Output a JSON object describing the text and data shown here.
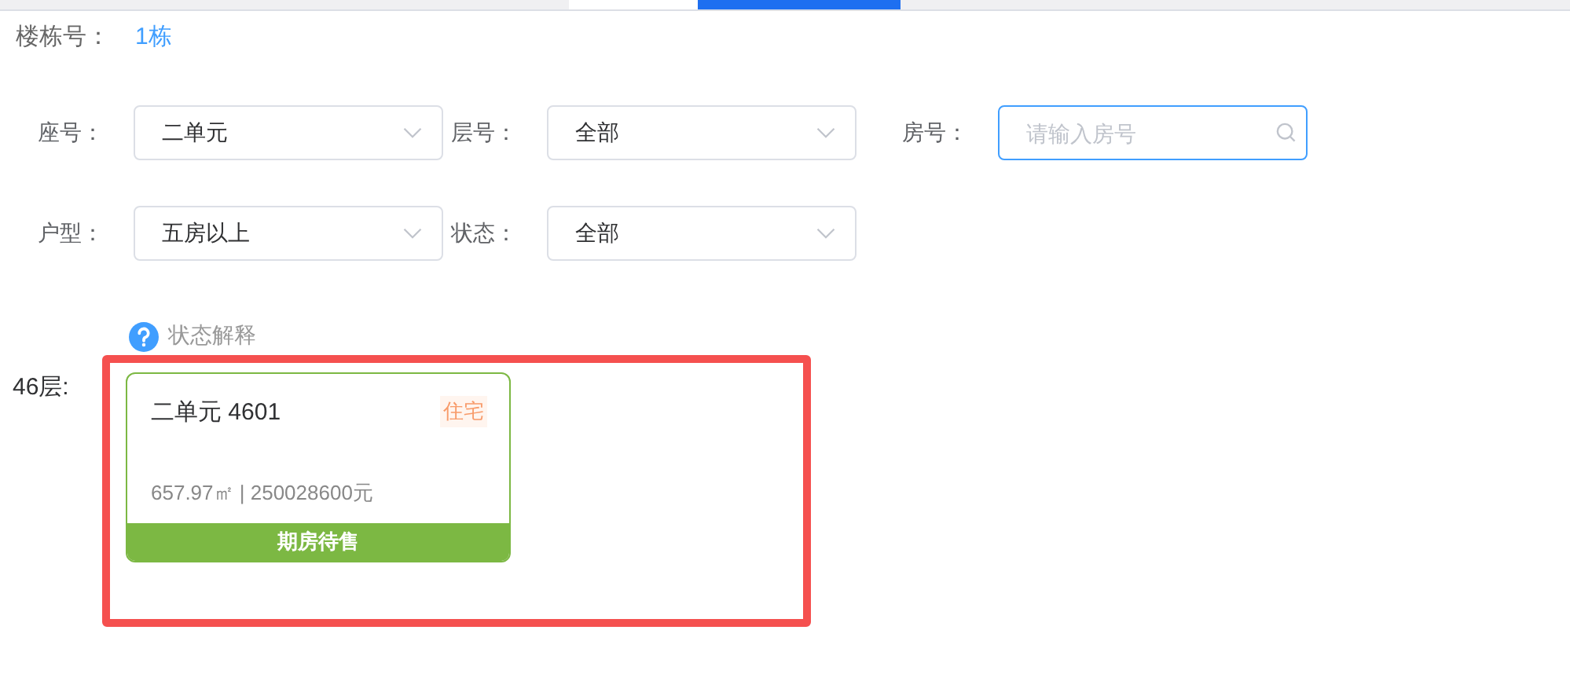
{
  "tabs": [
    {
      "selected": false
    },
    {
      "selected": true
    }
  ],
  "building": {
    "label": "楼栋号：",
    "value": "1栋"
  },
  "filters": [
    {
      "kind": "select",
      "label": "座号：",
      "value": "二单元"
    },
    {
      "kind": "select",
      "label": "层号：",
      "value": "全部"
    },
    {
      "kind": "search",
      "label": "房号：",
      "placeholder": "请输入房号",
      "focused": true
    },
    {
      "kind": "select",
      "label": "户型：",
      "value": "五房以上"
    },
    {
      "kind": "select",
      "label": "状态：",
      "value": "全部"
    }
  ],
  "legend": {
    "label": "状态解释"
  },
  "floors": [
    {
      "label": "46层:",
      "units": [
        {
          "title": "二单元 4601",
          "tag": "住宅",
          "info": "657.97㎡ | 250028600元",
          "status": "期房待售",
          "color": "#7cb843"
        }
      ]
    }
  ],
  "highlight": true
}
